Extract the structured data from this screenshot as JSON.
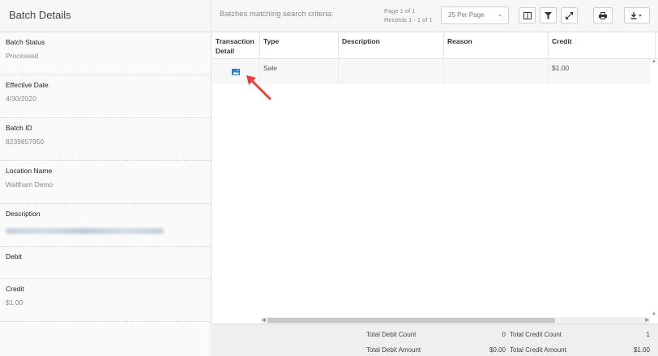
{
  "left_panel": {
    "title": "Batch Details",
    "fields": [
      {
        "label": "Batch Status",
        "value": "Processed"
      },
      {
        "label": "Effective Date",
        "value": "4/30/2020"
      },
      {
        "label": "Batch ID",
        "value": "8239857950"
      },
      {
        "label": "Location Name",
        "value": "Waltham Demo"
      },
      {
        "label": "Description",
        "value": ""
      },
      {
        "label": "Debit",
        "value": ""
      },
      {
        "label": "Credit",
        "value": "$1.00"
      }
    ]
  },
  "toolbar": {
    "criteria": "Batches matching search criteria:",
    "page": "Page 1 of 1",
    "records": "Records 1 - 1 of 1",
    "per_page": "25 Per Page",
    "icons": [
      "columns-icon",
      "filter-icon",
      "expand-icon",
      "print-icon",
      "download-icon"
    ]
  },
  "grid": {
    "columns": [
      "Transaction Detail",
      "Type",
      "Description",
      "Reason",
      "Credit"
    ],
    "rows": [
      {
        "type": "Sale",
        "description": "",
        "reason": "",
        "credit": "$1.00"
      }
    ]
  },
  "footer": {
    "debit_count_label": "Total Debit Count",
    "debit_count": "0",
    "credit_count_label": "Total Credit Count",
    "credit_count": "1",
    "debit_amount_label": "Total Debit Amount",
    "debit_amount": "$0.00",
    "credit_amount_label": "Total Credit Amount",
    "credit_amount": "$1.00"
  },
  "colors": {
    "accent": "#2f7fd1",
    "arrow": "#e8413a"
  }
}
